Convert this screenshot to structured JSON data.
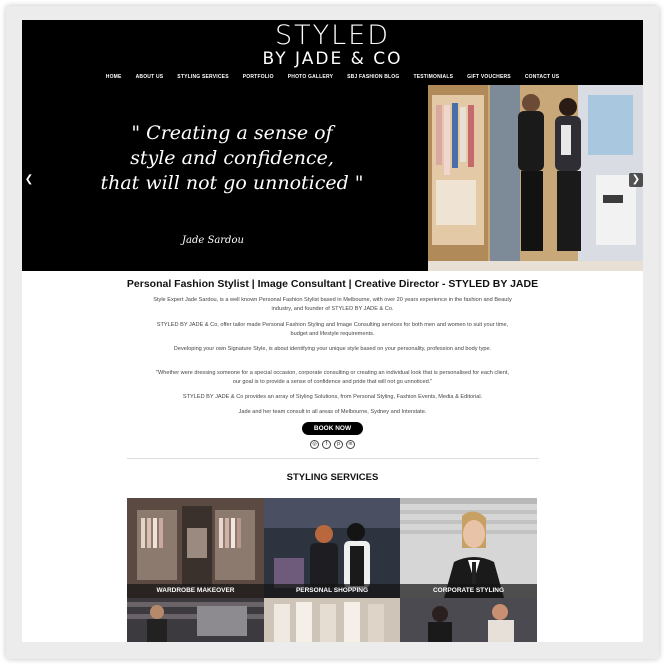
{
  "brand": {
    "name": "STYLED",
    "sub": "BY JADE & CO"
  },
  "nav": [
    "HOME",
    "ABOUT US",
    "STYLING SERVICES",
    "PORTFOLIO",
    "PHOTO GALLERY",
    "SBJ FASHION BLOG",
    "TESTIMONIALS",
    "GIFT VOUCHERS",
    "CONTACT US"
  ],
  "hero": {
    "quote_line1": "\" Creating a sense of",
    "quote_line2": "style and confidence,",
    "quote_line3": "that will not go unnoticed \"",
    "author": "Jade Sardou",
    "prev_icon": "arrow-left-icon",
    "next_icon": "arrow-right-icon"
  },
  "intro": {
    "title": "Personal Fashion Stylist | Image Consultant | Creative Director - STYLED BY JADE",
    "p1": "Style Expert Jade Sardou, is a well known Personal Fashion Stylist based in Melbourne, with over 20 years experience in the fashion and Beauty industry, and founder of STYLED BY JADE & Co.",
    "p2": "STYLED BY JADE & Co, offer tailor made Personal Fashion Styling and Image Consulting services for both men and women to suit your time, budget and lifestyle requirements.",
    "p3": "Developing your own Signature Style, is about identifying your unique style based on your personality, profession and body type.",
    "p4": "\"Whether were dressing someone for a special occasion, corporate consulting or creating an individual look that is personalised for each client, our goal is to provide a sense of confidence and pride that will not go unnoticed.\"",
    "p5": "STYLED BY JADE & Co provides an array of Styling Solutions, from Personal Styling, Fashion Events, Media & Editorial.",
    "p6": "Jade and her team consult in all areas of Melbourne, Sydney and Interstate.",
    "book_label": "BOOK NOW",
    "socials": [
      "instagram-icon",
      "facebook-icon",
      "pinterest-icon",
      "linkedin-icon"
    ]
  },
  "services": {
    "title": "STYLING SERVICES",
    "tiles": [
      "WARDROBE MAKEOVER",
      "PERSONAL SHOPPING",
      "CORPORATE STYLING"
    ]
  }
}
